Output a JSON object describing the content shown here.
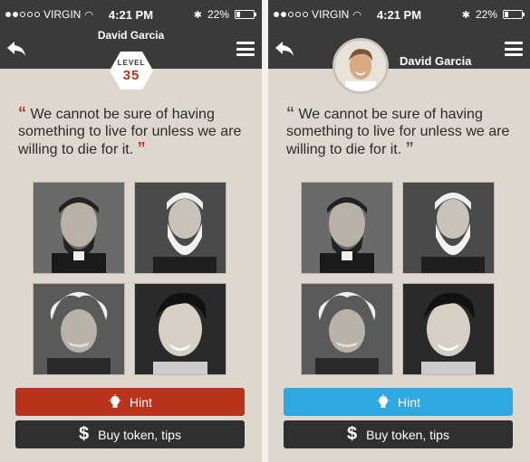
{
  "screens": [
    {
      "status": {
        "carrier": "VIRGIN",
        "time": "4:21 PM",
        "battery": "22%"
      },
      "user_name": "David Garcia",
      "level": {
        "label": "LEVEL",
        "value": "35"
      },
      "quote": "We cannot be sure of having something to live for unless we are willing to die for it.",
      "buttons": {
        "hint": "Hint",
        "buy": "Buy token, tips"
      },
      "hint_color": "#b8321c"
    },
    {
      "status": {
        "carrier": "VIRGIN",
        "time": "4:21 PM",
        "battery": "22%"
      },
      "user_name": "David Garcia",
      "quote": "We cannot be sure of having something to live for unless we are willing to die for it.",
      "buttons": {
        "hint": "Hint",
        "buy": "Buy token, tips"
      },
      "hint_color": "#2fa7e0"
    }
  ],
  "portraits": [
    "lincoln-portrait",
    "bearded-man-portrait",
    "einstein-portrait",
    "elvis-portrait"
  ],
  "icons": {
    "back": "back-arrow-icon",
    "menu": "hamburger-menu-icon",
    "hint": "lightbulb-icon",
    "buy": "dollar-icon",
    "wifi": "wifi-icon",
    "bluetooth": "bluetooth-icon"
  }
}
